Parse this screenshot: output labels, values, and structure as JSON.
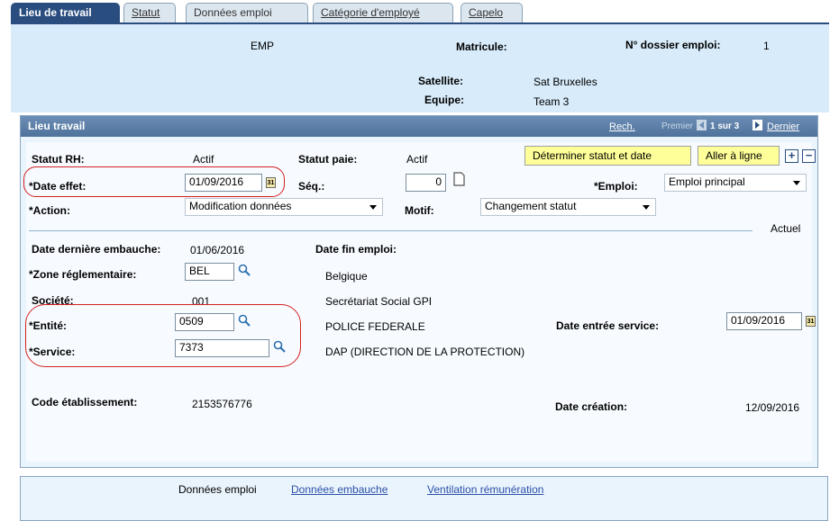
{
  "tabs": [
    {
      "label": "Lieu de travail",
      "active": true
    },
    {
      "label": "Statut",
      "active": false
    },
    {
      "label": "Données emploi",
      "active": false
    },
    {
      "label": "Catégorie d'employé",
      "active": false
    },
    {
      "label": "Capelo",
      "active": false
    }
  ],
  "header": {
    "emp": "EMP",
    "matricule_label": "Matricule:",
    "dossier_label": "N° dossier emploi:",
    "dossier_value": "1",
    "satellite_label": "Satellite:",
    "satellite_value": "Sat Bruxelles",
    "equipe_label": "Equipe:",
    "equipe_value": "Team 3"
  },
  "panel": {
    "title": "Lieu travail",
    "search_link": "Rech.",
    "first_label": "Premier",
    "position": "1 sur 3",
    "last_link": "Dernier"
  },
  "form": {
    "statut_rh_label": "Statut RH:",
    "statut_rh_value": "Actif",
    "statut_paie_label": "Statut paie:",
    "statut_paie_value": "Actif",
    "determine_button": "Déterminer statut et date",
    "aller_button": "Aller à ligne",
    "date_effet_label": "*Date effet:",
    "date_effet_value": "01/09/2016",
    "seq_label": "Séq.:",
    "seq_value": "0",
    "emploi_label": "*Emploi:",
    "emploi_value": "Emploi principal",
    "action_label": "*Action:",
    "action_value": "Modification données",
    "motif_label": "Motif:",
    "motif_value": "Changement statut",
    "actuel": "Actuel",
    "date_embauche_label": "Date dernière embauche:",
    "date_embauche_value": "01/06/2016",
    "date_fin_label": "Date fin emploi:",
    "zone_label": "*Zone réglementaire:",
    "zone_value": "BEL",
    "zone_desc": "Belgique",
    "societe_label": "Société:",
    "societe_value": "001",
    "societe_desc": "Secrétariat Social GPI",
    "entite_label": "*Entité:",
    "entite_value": "0509",
    "entite_desc": "POLICE FEDERALE",
    "date_entree_label": "Date entrée service:",
    "date_entree_value": "01/09/2016",
    "service_label": "*Service:",
    "service_value": "7373",
    "service_desc": "DAP (DIRECTION DE LA PROTECTION)",
    "code_etab_label": "Code établissement:",
    "code_etab_value": "2153576776",
    "date_creation_label": "Date création:",
    "date_creation_value": "12/09/2016"
  },
  "footer": {
    "donnees_emploi": "Données emploi",
    "donnees_embauche": "Données embauche",
    "ventilation": "Ventilation rémunération"
  },
  "colors": {
    "tab_active": "#2a4d80",
    "header_bg": "#d7ebfa",
    "panel_bar": "#4f729c",
    "button_yellow": "#ffff99",
    "highlight_oval": "#d42020"
  }
}
